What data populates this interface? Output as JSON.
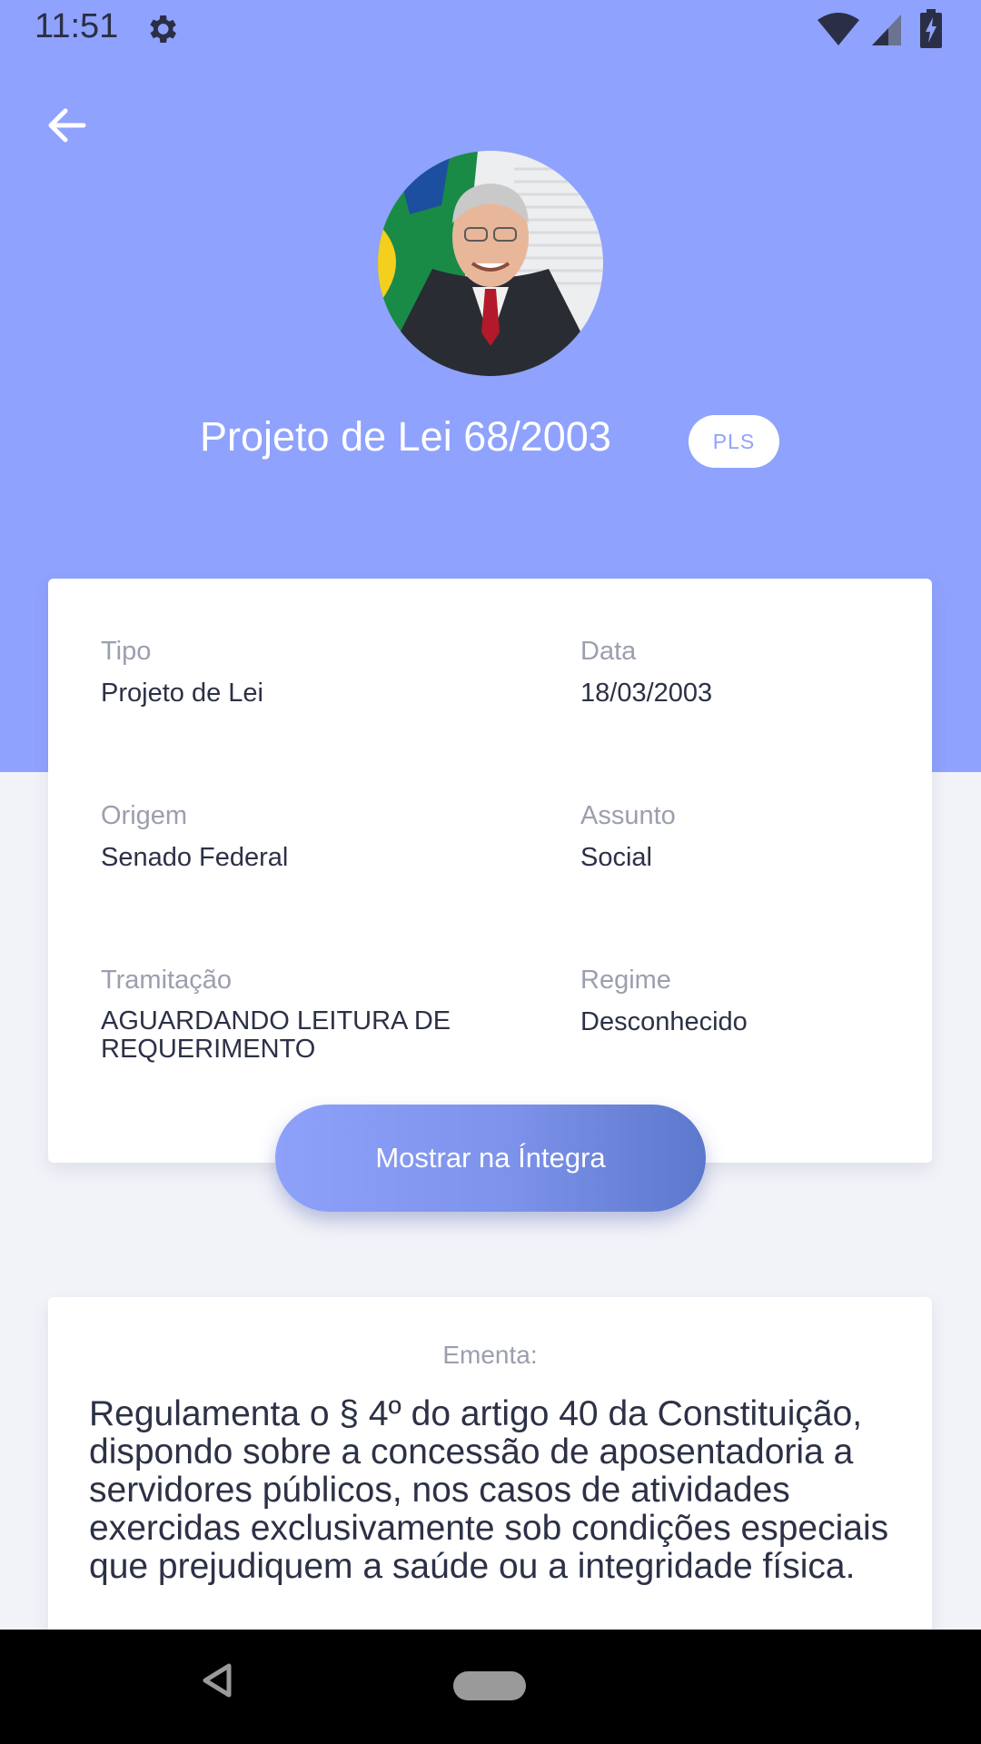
{
  "status_bar": {
    "time": "11:51",
    "icons": [
      "settings-gear-icon",
      "wifi-icon",
      "cell-signal-icon",
      "battery-charging-icon"
    ]
  },
  "header": {
    "back_icon": "arrow-left-icon",
    "title": "Projeto de Lei 68/2003",
    "badge": "PLS",
    "accent_color": "#8fa2fd"
  },
  "details": {
    "fields": [
      {
        "label": "Tipo",
        "value": "Projeto de Lei"
      },
      {
        "label": "Data",
        "value": "18/03/2003"
      },
      {
        "label": "Origem",
        "value": "Senado Federal"
      },
      {
        "label": "Assunto",
        "value": "Social"
      },
      {
        "label": "Tramitação",
        "value": "AGUARDANDO LEITURA DE REQUERIMENTO"
      },
      {
        "label": "Regime",
        "value": "Desconhecido"
      }
    ]
  },
  "actions": {
    "show_full_label": "Mostrar na Íntegra"
  },
  "summary": {
    "label": "Ementa:",
    "text": "Regulamenta o § 4º do artigo 40 da Constituição, dispondo sobre a concessão de aposentadoria a servidores públicos, nos casos de atividades exercidas exclusivamente sob condições especiais que prejudiquem a saúde ou a integridade física."
  },
  "nav_bar": {
    "icons": [
      "nav-back-icon",
      "nav-home-icon"
    ]
  }
}
